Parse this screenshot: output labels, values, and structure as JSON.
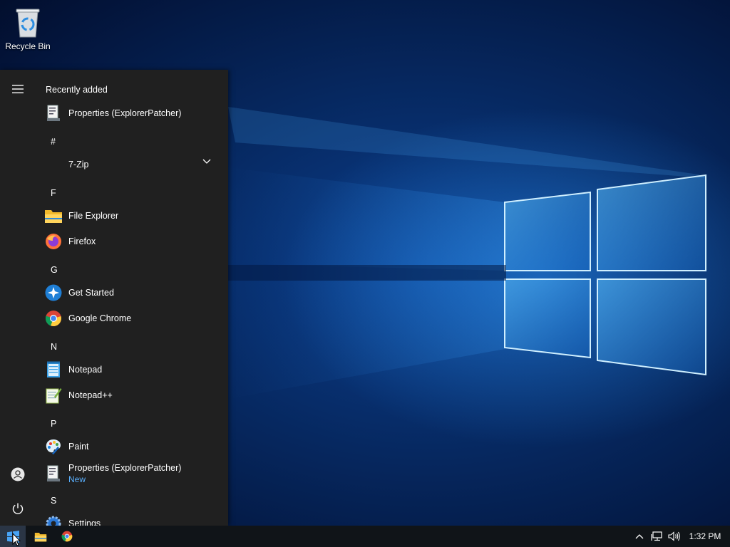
{
  "desktop": {
    "icons": [
      {
        "label": "Recycle Bin",
        "icon": "recycle-bin-icon"
      }
    ]
  },
  "start_menu": {
    "recently_added_label": "Recently added",
    "recent_item": {
      "label": "Properties (ExplorerPatcher)",
      "icon": "properties-icon"
    },
    "groups": [
      {
        "letter": "#",
        "apps": [
          {
            "label": "7-Zip",
            "icon": "folder-expand",
            "expandable": true
          }
        ]
      },
      {
        "letter": "F",
        "apps": [
          {
            "label": "File Explorer",
            "icon": "file-explorer-icon"
          },
          {
            "label": "Firefox",
            "icon": "firefox-icon"
          }
        ]
      },
      {
        "letter": "G",
        "apps": [
          {
            "label": "Get Started",
            "icon": "get-started-icon"
          },
          {
            "label": "Google Chrome",
            "icon": "chrome-icon"
          }
        ]
      },
      {
        "letter": "N",
        "apps": [
          {
            "label": "Notepad",
            "icon": "notepad-icon"
          },
          {
            "label": "Notepad++",
            "icon": "notepad-plus-plus-icon"
          }
        ]
      },
      {
        "letter": "P",
        "apps": [
          {
            "label": "Paint",
            "icon": "paint-icon"
          },
          {
            "label": "Properties (ExplorerPatcher)",
            "badge": "New",
            "icon": "properties-icon"
          }
        ]
      },
      {
        "letter": "S",
        "apps": [
          {
            "label": "Settings",
            "icon": "settings-icon"
          }
        ]
      }
    ],
    "rail": {
      "menu_icon": "hamburger-icon",
      "user_icon": "user-icon",
      "power_icon": "power-icon"
    }
  },
  "taskbar": {
    "pinned": [
      "start-icon",
      "file-explorer-icon",
      "chrome-icon"
    ],
    "tray": {
      "clock": "1:32 PM",
      "icons": [
        "chevron-up-icon",
        "network-icon",
        "volume-icon"
      ]
    }
  },
  "colors": {
    "start_bg": "#202020",
    "accent_new": "#5ab0ff",
    "taskbar_bg": "#101418"
  }
}
